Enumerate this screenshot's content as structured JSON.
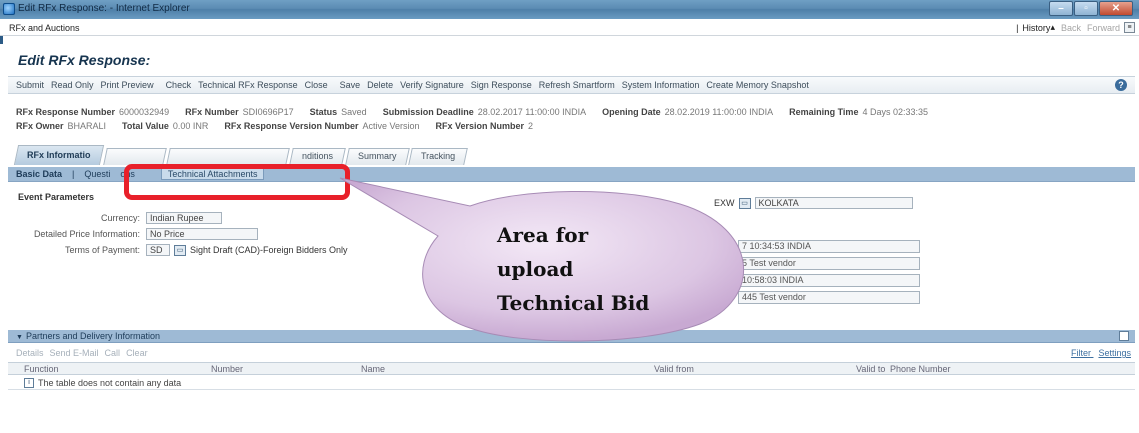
{
  "window": {
    "title": "Edit RFx Response: - Internet Explorer",
    "controls": [
      "–",
      "▫",
      "✕"
    ]
  },
  "app_header": {
    "title": "RFx and Auctions",
    "history": "History",
    "back": "Back",
    "forward": "Forward"
  },
  "page": {
    "title": "Edit RFx Response:"
  },
  "toolbar": {
    "items": [
      "Submit",
      "Read Only",
      "Print Preview",
      "Check",
      "Technical RFx Response",
      "Close",
      "Save",
      "Delete",
      "Verify Signature",
      "Sign Response",
      "Refresh Smartform",
      "System Information",
      "Create Memory Snapshot"
    ]
  },
  "header_info": {
    "rfx_response_number_label": "RFx Response Number",
    "rfx_response_number": "6000032949",
    "rfx_number_label": "RFx Number",
    "rfx_number": "SDI0696P17",
    "status_label": "Status",
    "status": "Saved",
    "submission_deadline_label": "Submission Deadline",
    "submission_deadline": "28.02.2017 11:00:00 INDIA",
    "opening_date_label": "Opening Date",
    "opening_date": "28.02.2019 11:00:00 INDIA",
    "remaining_time_label": "Remaining Time",
    "remaining_time": "4 Days 02:33:35",
    "rfx_owner_label": "RFx Owner",
    "rfx_owner": "BHARALI",
    "total_value_label": "Total Value",
    "total_value": "0.00 INR",
    "version_number_label": "RFx Response Version Number",
    "version_number": "Active Version",
    "rfx_version_label": "RFx Version Number",
    "rfx_version": "2"
  },
  "tabs": [
    {
      "label": "RFx Informatio",
      "active": true
    },
    {
      "label": "",
      "active": false
    },
    {
      "label": "",
      "active": false
    },
    {
      "label": "nditions",
      "active": false
    },
    {
      "label": "Summary",
      "active": false
    },
    {
      "label": "Tracking",
      "active": false
    }
  ],
  "subtabs": {
    "basic": "Basic Data",
    "questions": "Questi",
    "questions_tail": "ons",
    "technical": "Technical Attachments"
  },
  "event_parameters": {
    "title": "Event Parameters",
    "currency_label": "Currency:",
    "currency": "Indian Rupee",
    "price_info_label": "Detailed Price Information:",
    "price_info": "No Price",
    "payment_label": "Terms of Payment:",
    "payment_code": "SD",
    "payment_desc": "Sight Draft (CAD)-Foreign Bidders Only"
  },
  "right_fields": {
    "incoterm": "EXW",
    "location": "KOLKATA",
    "time1": "7 10:34:53 INDIA",
    "vendor1": "5 Test vendor",
    "time2": "10:58:03 INDIA",
    "vendor2": "445 Test vendor"
  },
  "partners": {
    "title": "Partners and Delivery Information",
    "toolbar": [
      "Details",
      "Send E-Mail",
      "Call",
      "Clear"
    ],
    "filter": "Filter",
    "settings": "Settings",
    "columns": [
      "Function",
      "Number",
      "Name",
      "Valid from",
      "Valid to",
      "Phone Number"
    ],
    "empty": "The table does not contain any data"
  },
  "callout": {
    "line1": "Area for",
    "line2": "upload",
    "line3": "Technical Bid"
  },
  "colors": {
    "highlight": "#e8202a",
    "callout_fill": "#d8c2e0",
    "panel": "#9ebad5"
  }
}
